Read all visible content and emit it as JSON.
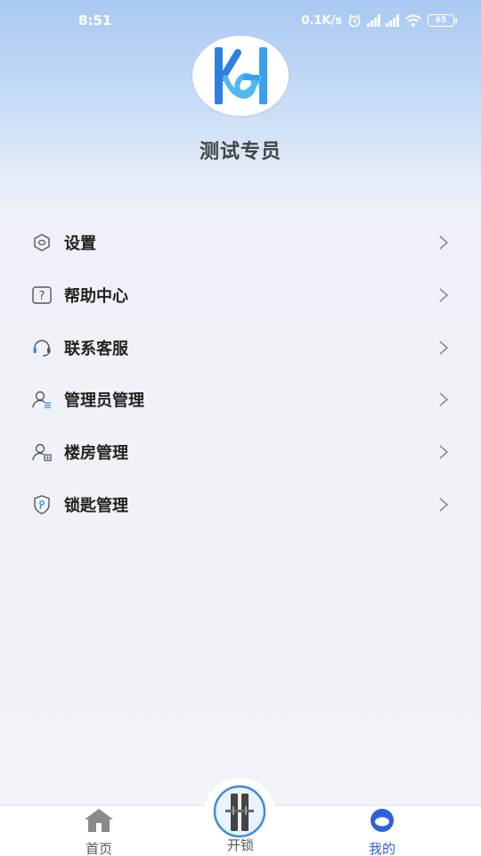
{
  "status_bar": {
    "time": "8:51",
    "network_speed": "0.1K/s",
    "battery": "65",
    "icons": [
      "alarm-icon",
      "signal-hd-icon",
      "signal-hd-icon",
      "wifi-icon",
      "battery-icon"
    ]
  },
  "profile": {
    "logo_icon": "kh-logo",
    "name": "测试专员"
  },
  "menu": {
    "items": [
      {
        "label": "设置",
        "icon": "settings-hexagon-icon"
      },
      {
        "label": "帮助中心",
        "icon": "help-question-icon"
      },
      {
        "label": "联系客服",
        "icon": "headset-icon"
      },
      {
        "label": "管理员管理",
        "icon": "admin-user-icon"
      },
      {
        "label": "楼房管理",
        "icon": "building-user-icon"
      },
      {
        "label": "锁匙管理",
        "icon": "key-shield-icon"
      }
    ]
  },
  "tabbar": {
    "home_label": "首页",
    "unlock_label": "开锁",
    "mine_label": "我的",
    "active": "mine",
    "colors": {
      "active": "#2d62d8",
      "inactive": "#555555"
    }
  }
}
